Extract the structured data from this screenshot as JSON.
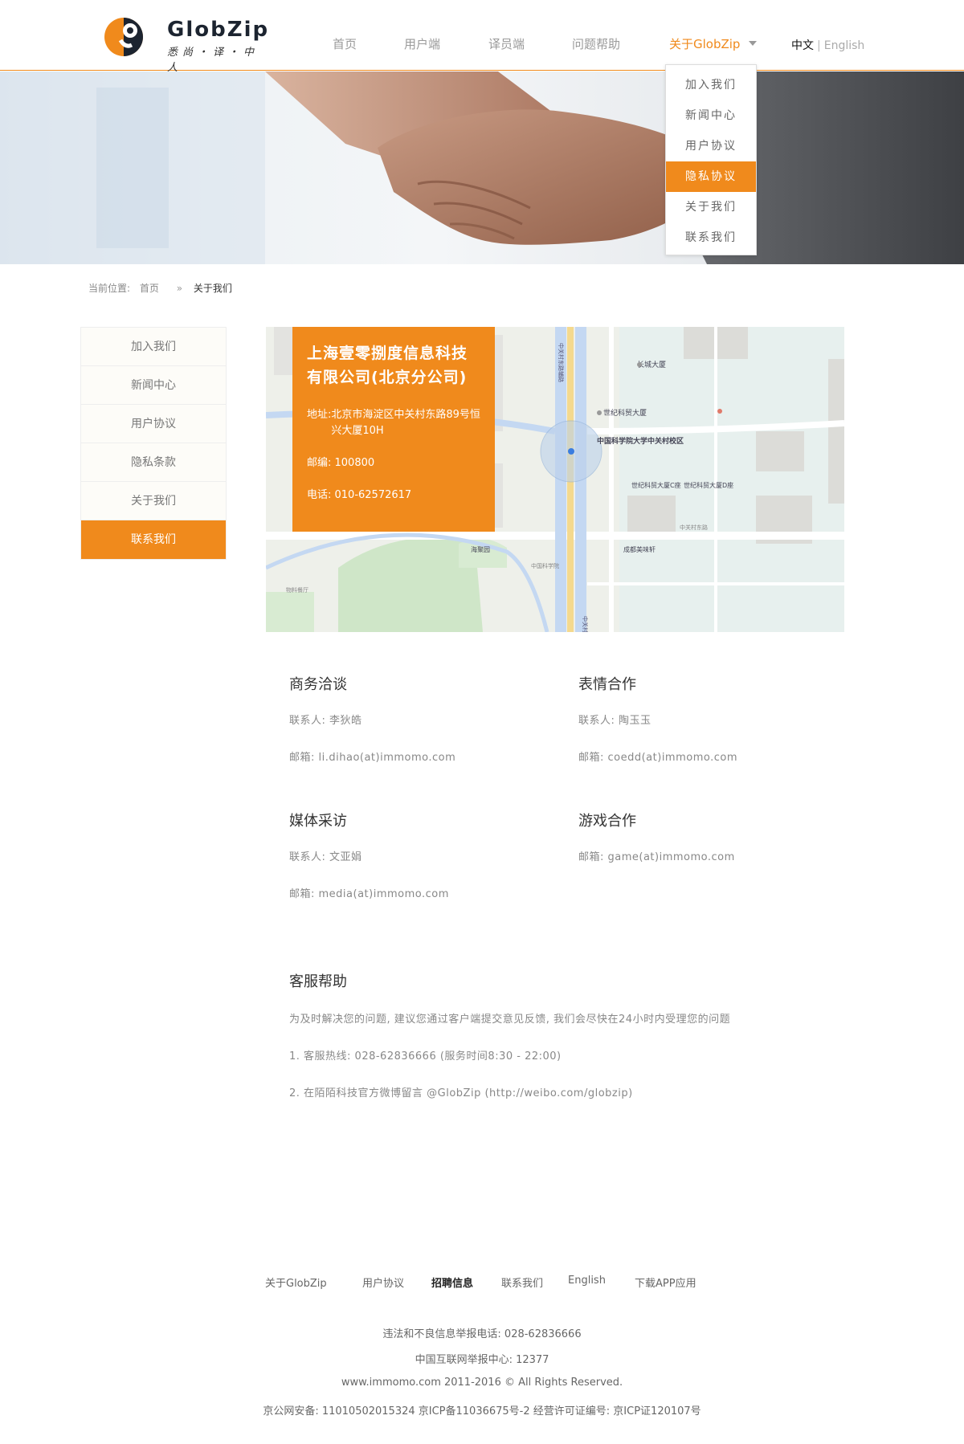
{
  "header": {
    "brand": "GlobZip",
    "slogan": "悉尚・译・中人",
    "nav": [
      "首页",
      "用户端",
      "译员端",
      "问题帮助",
      "关于GlobZip"
    ],
    "lang_zh": "中文",
    "lang_sep": "|",
    "lang_en": "English",
    "accent_color": "#f08a1c"
  },
  "dropdown": {
    "items": [
      "加入我们",
      "新闻中心",
      "用户协议",
      "隐私协议",
      "关于我们",
      "联系我们"
    ],
    "active_index": 3
  },
  "breadcrumb": {
    "label": "当前位置:",
    "home": "首页",
    "arrow": "»",
    "current": "关于我们"
  },
  "sidebar": {
    "items": [
      "加入我们",
      "新闻中心",
      "用户协议",
      "隐私条款",
      "关于我们",
      "联系我们"
    ],
    "active_index": 5
  },
  "company": {
    "name": "上海壹零捌度信息科技有限公司(北京分公司)",
    "address_label": "地址:",
    "address": "北京市海淀区中关村东路89号恒兴大厦10H",
    "postcode": "邮编: 100800",
    "phone": "电话: 010-62572617"
  },
  "map": {
    "labels": [
      "中关村东路辅路",
      "中关村东路",
      "中国科学院大学中关村校区",
      "长城大厦",
      "世纪科贸大厦",
      "世纪科贸大厦C座",
      "世纪科贸大厦D座",
      "中关村东路",
      "海聚园",
      "成都美味轩",
      "中国科学院",
      "物料餐厅"
    ]
  },
  "contacts": [
    {
      "title": "商务洽谈",
      "person": "联系人: 李狄皓",
      "email": "邮箱: li.dihao(at)immomo.com"
    },
    {
      "title": "表情合作",
      "person": "联系人: 陶玉玉",
      "email": "邮箱: coedd(at)immomo.com"
    },
    {
      "title": "媒体采访",
      "person": "联系人: 文亚娟",
      "email": "邮箱: media(at)immomo.com"
    },
    {
      "title": "游戏合作",
      "email": "邮箱: game(at)immomo.com"
    }
  ],
  "service": {
    "title": "客服帮助",
    "intro": "为及时解决您的问题, 建议您通过客户端提交意见反馈, 我们会尽快在24小时内受理您的问题",
    "line1": "1. 客服热线: 028-62836666 (服务时间8:30 - 22:00)",
    "line2": "2. 在陌陌科技官方微博留言 @GlobZip (http://weibo.com/globzip)"
  },
  "footer": {
    "links": [
      "关于GlobZip",
      "用户协议",
      "招聘信息",
      "联系我们",
      "English",
      "下载APP应用"
    ],
    "report_phone": "违法和不良信息举报电话: 028-62836666",
    "report_center": "中国互联网举报中心: 12377",
    "copyright": "www.immomo.com 2011-2016 © All Rights Reserved.",
    "icp": "京公网安备: 11010502015324 京ICP备11036675号-2 经营许可证编号: 京ICP证120107号"
  }
}
